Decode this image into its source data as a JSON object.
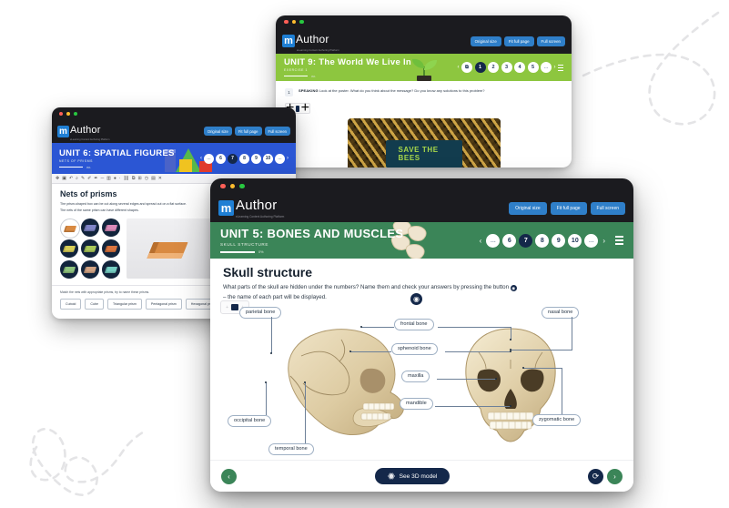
{
  "brand": {
    "logo_letter": "m",
    "logo_word": "Author",
    "logo_tagline": "eLearning Content Authoring Platform"
  },
  "window_controls": {
    "close": "close-dot",
    "minimize": "minimize-dot",
    "maximize": "maximize-dot"
  },
  "view_buttons": {
    "original": "Original size",
    "fit": "Fit full page",
    "fullscreen": "Full screen"
  },
  "unit9": {
    "title": "UNIT 9: The World We Live In",
    "subtitle": "EXERCISE 1",
    "progress_pct": "0%",
    "pager": {
      "prev": "‹",
      "next": "›",
      "items": [
        "⧉",
        "1",
        "2",
        "3",
        "4",
        "5",
        "..."
      ],
      "active_index": 1,
      "menu": "menu-icon"
    },
    "exercise": {
      "number": "1",
      "label": "SPEAKING",
      "text": "Look at the poster. What do you think about the message? Do you know any solutions to this problem?"
    },
    "poster": {
      "caption": "SAVE THE BEES",
      "image_alt": "honey bees on honeycomb"
    },
    "header_image_alt": "seedling sprout"
  },
  "unit6": {
    "title": "UNIT 6: SPATIAL FIGURES",
    "subtitle": "NETS OF PRISMS",
    "progress_pct": "0%",
    "pager": {
      "prev": "‹",
      "next": "›",
      "items": [
        "...",
        "6",
        "7",
        "8",
        "9",
        "10",
        "..."
      ],
      "active_index": 2,
      "menu": "menu-icon"
    },
    "heading": "Nets of prisms",
    "paragraphs": [
      "The prism-shaped box can be cut along several edges and spread out on a flat surface.",
      "The nets of the same prism can have different shapes."
    ],
    "task": "Match the nets with appropriate prisms, try to name these prisms.",
    "answers": [
      "Cuboid",
      "Cube",
      "Triangular prism",
      "Pentagonal prism",
      "Hexagonal prism"
    ],
    "swatch_colors": [
      "#d98a42",
      "#7f84c7",
      "#d98ab9",
      "#d8cf58",
      "#a9c85a",
      "#d9743f",
      "#8fc47e",
      "#d1a384",
      "#76cfc4"
    ],
    "toolbar_icons": [
      "pointer-icon",
      "stamp-icon",
      "undo-icon",
      "zoom-icon",
      "pen-icon",
      "highlighter-icon",
      "eraser-icon",
      "line-icon",
      "grid-icon",
      "color-icon",
      "dropper-icon",
      "link-icon",
      "copy-icon",
      "columns-icon",
      "clock-icon",
      "image-icon",
      "close-icon"
    ]
  },
  "unit5": {
    "title": "UNIT 5: BONES AND MUSCLES",
    "subtitle": "SKULL STRUCTURE",
    "progress_pct": "0%",
    "pager": {
      "prev": "‹",
      "next": "›",
      "items": [
        "...",
        "6",
        "7",
        "8",
        "9",
        "10",
        "..."
      ],
      "active_index": 2,
      "menu": "menu-icon"
    },
    "heading": "Skull structure",
    "intro_line1": "What parts of the skull are hidden under the numbers? Name them and check your answers by pressing the button",
    "intro_line2": "– the name of each part will be displayed.",
    "reveal_icon": "eye-icon",
    "labels": [
      {
        "text": "parietal bone"
      },
      {
        "text": "nasal bone"
      },
      {
        "text": "frontal bone"
      },
      {
        "text": "sphenoid bone"
      },
      {
        "text": "maxilla"
      },
      {
        "text": "mandible"
      },
      {
        "text": "occipital bone"
      },
      {
        "text": "temporal bone"
      },
      {
        "text": "zygomatic bone"
      }
    ],
    "footer": {
      "prev": "‹",
      "next": "›",
      "reset": "reset-icon",
      "model_button": "See 3D model",
      "model_icon": "atom-icon"
    },
    "header_image_alt": "vertebrae bones"
  },
  "decor": {
    "top_right": "dashed-loop-decoration",
    "bottom_left": "dashed-swirl-decoration",
    "color": "#e4e4e6"
  },
  "colors": {
    "unit5_green": "#3b8558",
    "unit9_green": "#8dc63f",
    "unit6_blue": "#2b56d4",
    "navy": "#14284a",
    "appbar": "#1b1b1f",
    "btn_blue": "#2f7fc9"
  }
}
